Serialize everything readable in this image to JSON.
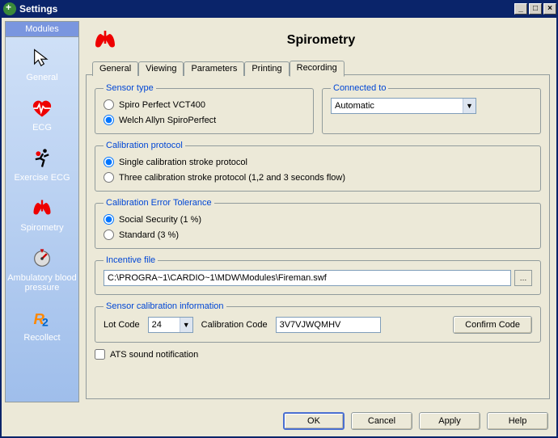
{
  "window": {
    "title": "Settings"
  },
  "sidebar": {
    "header": "Modules",
    "items": [
      {
        "label": "General"
      },
      {
        "label": "ECG"
      },
      {
        "label": "Exercise ECG"
      },
      {
        "label": "Spirometry"
      },
      {
        "label": "Ambulatory blood pressure"
      },
      {
        "label": "Recollect"
      }
    ]
  },
  "main": {
    "title": "Spirometry"
  },
  "tabs": [
    {
      "label": "General"
    },
    {
      "label": "Viewing"
    },
    {
      "label": "Parameters"
    },
    {
      "label": "Printing"
    },
    {
      "label": "Recording"
    }
  ],
  "sensor_type": {
    "legend": "Sensor type",
    "opt1": "Spiro Perfect VCT400",
    "opt2": "Welch Allyn SpiroPerfect"
  },
  "connected": {
    "legend": "Connected to",
    "value": "Automatic"
  },
  "calib_protocol": {
    "legend": "Calibration protocol",
    "opt1": "Single calibration stroke protocol",
    "opt2": "Three calibration stroke protocol (1,2 and 3 seconds flow)"
  },
  "calib_error": {
    "legend": "Calibration Error Tolerance",
    "opt1": "Social Security (1 %)",
    "opt2": "Standard (3 %)"
  },
  "incentive": {
    "legend": "Incentive file",
    "path": "C:\\PROGRA~1\\CARDIO~1\\MDW\\Modules\\Fireman.swf"
  },
  "sensor_cal": {
    "legend": "Sensor calibration information",
    "lot_label": "Lot Code",
    "lot_value": "24",
    "cal_label": "Calibration Code",
    "cal_value": "3V7VJWQMHV",
    "confirm": "Confirm Code"
  },
  "ats_label": "ATS sound notification",
  "buttons": {
    "ok": "OK",
    "cancel": "Cancel",
    "apply": "Apply",
    "help": "Help"
  }
}
